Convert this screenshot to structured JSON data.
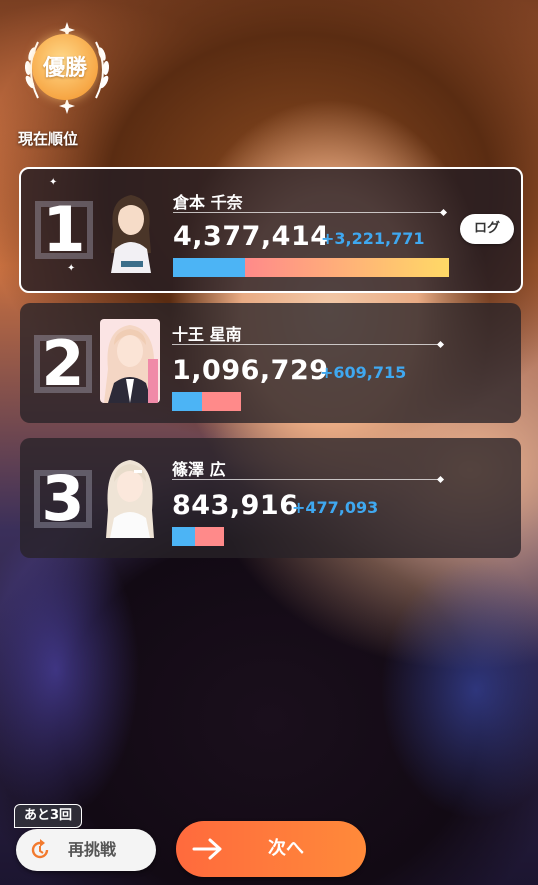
{
  "header": {
    "badge_label": "優勝",
    "rank_title": "現在順位"
  },
  "ranking": [
    {
      "rank": "1",
      "name": "倉本 千奈",
      "score": "4,377,414",
      "gain": "+3,221,771",
      "bar_blue_fraction": 0.26,
      "bar_fraction": 1.0
    },
    {
      "rank": "2",
      "name": "十王 星南",
      "score": "1,096,729",
      "gain": "+609,715",
      "bar_blue_fraction": 0.44,
      "bar_fraction": 0.25
    },
    {
      "rank": "3",
      "name": "篠澤 広",
      "score": "843,916",
      "gain": "+477,093",
      "bar_blue_fraction": 0.43,
      "bar_fraction": 0.19
    }
  ],
  "log_button": "ログ",
  "footer": {
    "retry_remaining": "あと3回",
    "retry_label": "再挑戦",
    "next_label": "次へ"
  },
  "colors": {
    "bar_blue": "#4cb4f5",
    "bar_pink": "#ff8a8a",
    "bar_yellow": "#ffd966",
    "gain_blue": "#3fa8f0",
    "next_orange": "#ff6a3d"
  },
  "icons": {
    "retry": "refresh-icon",
    "next": "arrow-right-icon",
    "badge": "laurel-icon"
  }
}
